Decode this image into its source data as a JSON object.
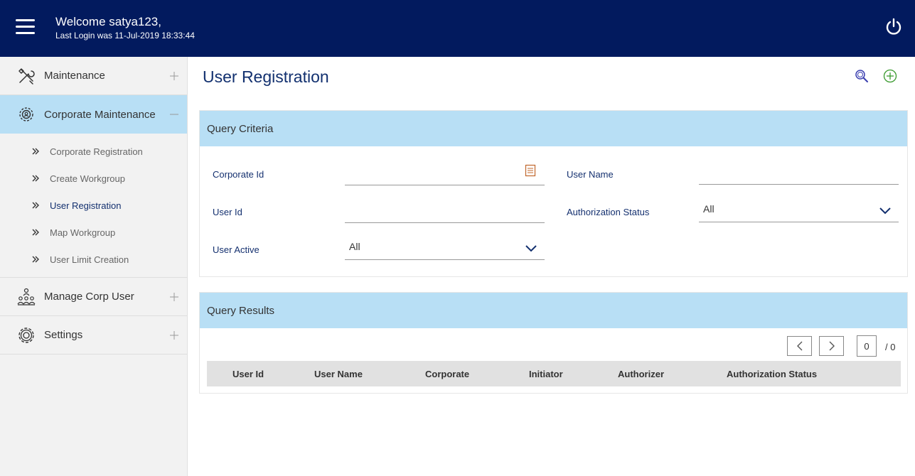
{
  "header": {
    "welcome": "Welcome satya123,",
    "last_login": "Last Login was 11-Jul-2019 18:33:44",
    "menu_icon": "hamburger-icon",
    "logout_icon": "power-icon",
    "bg_color": "#021a5e"
  },
  "sidebar": {
    "items": [
      {
        "label": "Maintenance",
        "icon": "tools-icon",
        "toggle": "plus"
      },
      {
        "label": "Corporate Maintenance",
        "icon": "corporate-gear-icon",
        "toggle": "minus"
      },
      {
        "label": "Manage Corp User",
        "icon": "users-hierarchy-icon",
        "toggle": "plus"
      },
      {
        "label": "Settings",
        "icon": "gear-icon",
        "toggle": "plus"
      }
    ],
    "subitems": [
      "Corporate Registration",
      "Create Workgroup",
      "User Registration",
      "Map Workgroup",
      "User Limit Creation"
    ],
    "active_color": "#b8dff5"
  },
  "main": {
    "title": "User Registration",
    "search_icon": "search-icon",
    "add_icon": "add-circle-icon",
    "query_criteria": {
      "heading": "Query Criteria",
      "corporate_id_label": "Corporate Id",
      "corporate_id_value": "",
      "user_name_label": "User Name",
      "user_name_value": "",
      "user_id_label": "User Id",
      "user_id_value": "",
      "auth_status_label": "Authorization Status",
      "auth_status_value": "All",
      "user_active_label": "User Active",
      "user_active_value": "All"
    },
    "query_results": {
      "heading": "Query Results",
      "page_current": "0",
      "page_total": "/ 0",
      "columns": [
        "User Id",
        "User Name",
        "Corporate",
        "Initiator",
        "Authorizer",
        "Authorization Status"
      ]
    }
  }
}
